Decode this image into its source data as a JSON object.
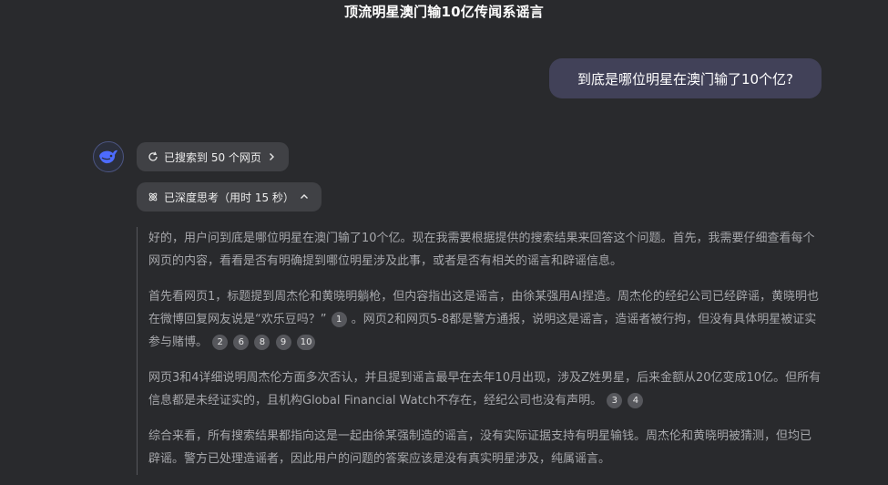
{
  "conversation": {
    "title": "顶流明星澳门输10亿传闻系谣言"
  },
  "user_message": {
    "text": "到底是哪位明星在澳门输了10个亿?"
  },
  "assistant": {
    "avatar_icon": "whale-logo-icon",
    "search_pill": {
      "label": "已搜索到 50 个网页",
      "icon": "search-refresh-icon",
      "chevron": "chevron-right-icon"
    },
    "think_pill": {
      "label": "已深度思考（用时 15 秒）",
      "icon": "atom-icon",
      "chevron": "chevron-up-icon"
    },
    "paragraphs": [
      {
        "text": "好的，用户问到底是哪位明星在澳门输了10个亿。现在我需要根据提供的搜索结果来回答这个问题。首先，我需要仔细查看每个网页的内容，看看是否有明确提到哪位明星涉及此事，或者是否有相关的谣言和辟谣信息。",
        "citations": []
      },
      {
        "text": "首先看网页1，标题提到周杰伦和黄晓明躺枪，但内容指出这是谣言，由徐某强用AI捏造。周杰伦的经纪公司已经辟谣，黄晓明也在微博回复网友说是“欢乐豆吗？”",
        "citations": [
          "1"
        ],
        "text2": "。网页2和网页5-8都是警方通报，说明这是谣言，造谣者被行拘，但没有具体明星被证实参与赌博。",
        "citations2": [
          "2",
          "6",
          "8",
          "9",
          "10"
        ]
      },
      {
        "text": "网页3和4详细说明周杰伦方面多次否认，并且提到谣言最早在去年10月出现，涉及Z姓男星，后来金额从20亿变成10亿。但所有信息都是未经证实的，且机构Global Financial Watch不存在，经纪公司也没有声明。",
        "citations": [
          "3",
          "4"
        ]
      },
      {
        "text": "综合来看，所有搜索结果都指向这是一起由徐某强制造的谣言，没有实际证据支持有明星输钱。周杰伦和黄晓明被猜测，但均已辟谣。警方已处理造谣者，因此用户的问题的答案应该是没有真实明星涉及，纯属谣言。",
        "citations": []
      }
    ]
  },
  "colors": {
    "background": "#292a2d",
    "user_bubble": "#414158",
    "pill": "#404145",
    "thought_text": "#a6a7ab",
    "citation_badge": "#56575c"
  }
}
